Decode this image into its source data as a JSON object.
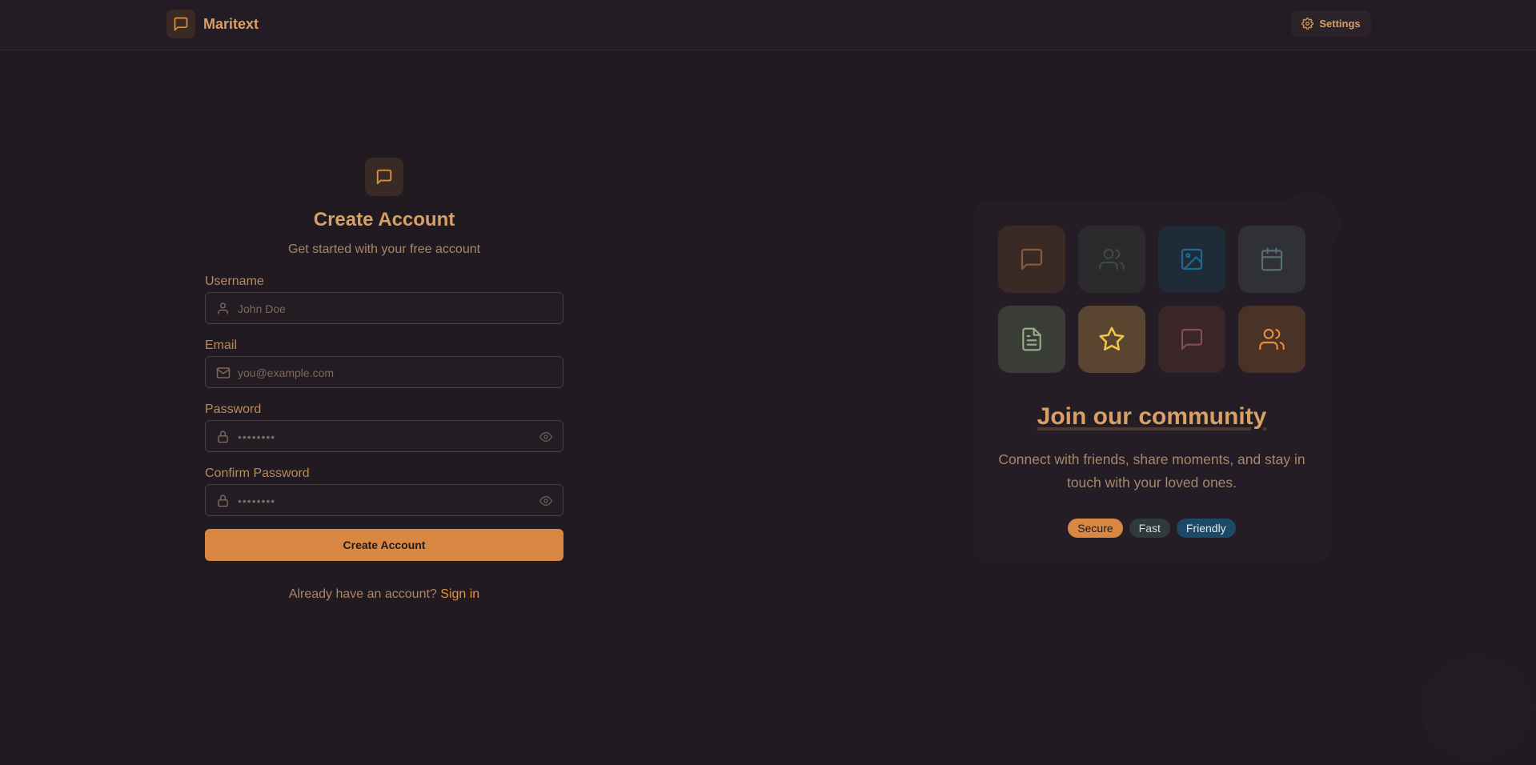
{
  "header": {
    "brand_name": "Maritext",
    "brand_icon": "message-square-icon",
    "settings_label": "Settings",
    "settings_icon": "gear-icon"
  },
  "form": {
    "logo_icon": "message-square-icon",
    "title": "Create Account",
    "subtitle": "Get started with your free account",
    "fields": [
      {
        "label": "Username",
        "placeholder": "John Doe",
        "icon": "user-icon"
      },
      {
        "label": "Email",
        "placeholder": "you@example.com",
        "icon": "mail-icon"
      },
      {
        "label": "Password",
        "placeholder": "••••••••",
        "icon": "lock-icon",
        "toggle_icon": "eye-icon"
      },
      {
        "label": "Confirm Password",
        "placeholder": "••••••••",
        "icon": "lock-icon",
        "toggle_icon": "eye-icon"
      }
    ],
    "submit_label": "Create Account",
    "signin_prompt": "Already have an account?",
    "signin_link": "Sign in"
  },
  "promo": {
    "tiles": [
      {
        "icon": "message-square-icon",
        "bg": "#3a2a26",
        "fg": "#8a5a3c"
      },
      {
        "icon": "users-icon",
        "bg": "#2b2a2c",
        "fg": "#3e4a4a"
      },
      {
        "icon": "image-icon",
        "bg": "#1f2c38",
        "fg": "#1e5e80"
      },
      {
        "icon": "calendar-icon",
        "bg": "#2f3136",
        "fg": "#5a7078"
      },
      {
        "icon": "file-text-icon",
        "bg": "#3a3c36",
        "fg": "#9aac8a"
      },
      {
        "icon": "star-icon",
        "bg": "#5a4630",
        "fg": "#f2c64a"
      },
      {
        "icon": "message-square-icon",
        "bg": "#3a2629",
        "fg": "#8a4e50"
      },
      {
        "icon": "users-icon",
        "bg": "#4a3227",
        "fg": "#e0903f"
      }
    ],
    "title": "Join our community",
    "description": "Connect with friends, share moments, and stay in touch with your loved ones.",
    "badges": [
      {
        "label": "Secure",
        "bg": "#d98843",
        "fg": "#1e1a1d"
      },
      {
        "label": "Fast",
        "bg": "#2f3a3c",
        "fg": "#d8d8d8"
      },
      {
        "label": "Friendly",
        "bg": "#1c4a66",
        "fg": "#e0e8f0"
      }
    ]
  },
  "colors": {
    "background": "#211a21",
    "accent": "#d98843",
    "text_accent": "#d8a065"
  }
}
